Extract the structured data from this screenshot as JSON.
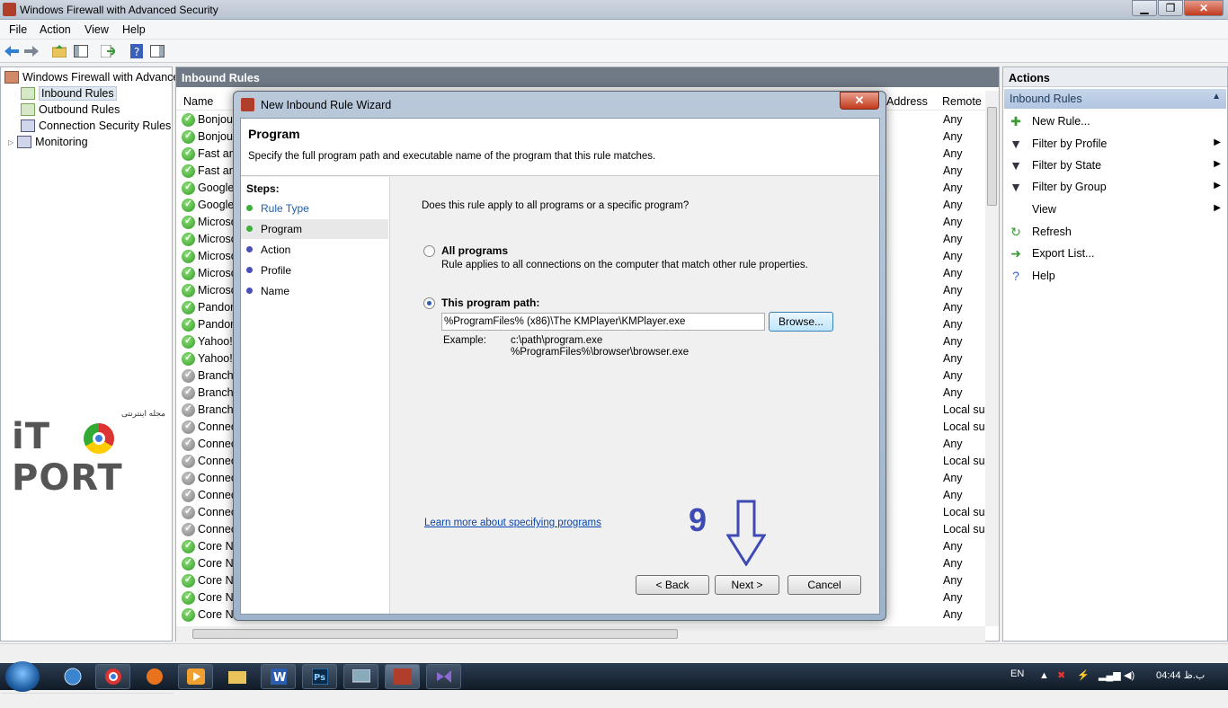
{
  "window": {
    "title": "Windows Firewall with Advanced Security",
    "min": "▁",
    "max": "❐",
    "close": "✕"
  },
  "menu": [
    "File",
    "Action",
    "View",
    "Help"
  ],
  "tree": {
    "root": "Windows Firewall with Advance",
    "items": [
      "Inbound Rules",
      "Outbound Rules",
      "Connection Security Rules",
      "Monitoring"
    ]
  },
  "watermark": {
    "text": "iT PORT",
    "sub": "مجله اینترنتی"
  },
  "center": {
    "header": "Inbound Rules",
    "columns": [
      "Name",
      "Address",
      "Remote"
    ],
    "rows": [
      {
        "name": "Bonjou",
        "remote": "Any",
        "enabled": true
      },
      {
        "name": "Bonjou",
        "remote": "Any",
        "enabled": true
      },
      {
        "name": "Fast an",
        "remote": "Any",
        "enabled": true
      },
      {
        "name": "Fast an",
        "remote": "Any",
        "enabled": true
      },
      {
        "name": "Google",
        "remote": "Any",
        "enabled": true
      },
      {
        "name": "Google",
        "remote": "Any",
        "enabled": true
      },
      {
        "name": "Microso",
        "remote": "Any",
        "enabled": true
      },
      {
        "name": "Microso",
        "remote": "Any",
        "enabled": true
      },
      {
        "name": "Microso",
        "remote": "Any",
        "enabled": true
      },
      {
        "name": "Microso",
        "remote": "Any",
        "enabled": true
      },
      {
        "name": "Microso",
        "remote": "Any",
        "enabled": true
      },
      {
        "name": "Pandora",
        "remote": "Any",
        "enabled": true
      },
      {
        "name": "Pandora",
        "remote": "Any",
        "enabled": true
      },
      {
        "name": "Yahoo!",
        "remote": "Any",
        "enabled": true
      },
      {
        "name": "Yahoo!",
        "remote": "Any",
        "enabled": true
      },
      {
        "name": "BranchC",
        "remote": "Any",
        "enabled": false
      },
      {
        "name": "BranchC",
        "remote": "Any",
        "enabled": false
      },
      {
        "name": "BranchC",
        "remote": "Local su",
        "enabled": false
      },
      {
        "name": "Connec",
        "remote": "Local su",
        "enabled": false
      },
      {
        "name": "Connec",
        "remote": "Any",
        "enabled": false
      },
      {
        "name": "Connec",
        "remote": "Local su",
        "enabled": false
      },
      {
        "name": "Connec",
        "remote": "Any",
        "enabled": false
      },
      {
        "name": "Connec",
        "remote": "Any",
        "enabled": false
      },
      {
        "name": "Connec",
        "remote": "Local su",
        "enabled": false
      },
      {
        "name": "Connec",
        "remote": "Local su",
        "enabled": false
      },
      {
        "name": "Core Ne",
        "remote": "Any",
        "enabled": true
      },
      {
        "name": "Core Ne",
        "remote": "Any",
        "enabled": true
      },
      {
        "name": "Core Ne",
        "remote": "Any",
        "enabled": true
      },
      {
        "name": "Core Ne",
        "remote": "Any",
        "enabled": true
      },
      {
        "name": "Core Ne",
        "remote": "Any",
        "enabled": true
      }
    ]
  },
  "actions": {
    "header": "Actions",
    "section": "Inbound Rules",
    "items": [
      {
        "label": "New Rule...",
        "icon": "new-rule-icon",
        "submenu": false
      },
      {
        "label": "Filter by Profile",
        "icon": "filter-icon",
        "submenu": true
      },
      {
        "label": "Filter by State",
        "icon": "filter-icon",
        "submenu": true
      },
      {
        "label": "Filter by Group",
        "icon": "filter-icon",
        "submenu": true
      },
      {
        "label": "View",
        "icon": "",
        "submenu": true
      },
      {
        "label": "Refresh",
        "icon": "refresh-icon",
        "submenu": false
      },
      {
        "label": "Export List...",
        "icon": "export-icon",
        "submenu": false
      },
      {
        "label": "Help",
        "icon": "help-icon",
        "submenu": false
      }
    ]
  },
  "dialog": {
    "title": "New Inbound Rule Wizard",
    "heading": "Program",
    "description": "Specify the full program path and executable name of the program that this rule matches.",
    "steps_title": "Steps:",
    "steps": [
      "Rule Type",
      "Program",
      "Action",
      "Profile",
      "Name"
    ],
    "question": "Does this rule apply to all programs or a specific program?",
    "all_programs_label": "All programs",
    "all_programs_desc": "Rule applies to all connections on the computer that match other rule properties.",
    "this_path_label": "This program path:",
    "path_value": "%ProgramFiles% (x86)\\The KMPlayer\\KMPlayer.exe",
    "browse": "Browse...",
    "example_label": "Example:",
    "example_1": "c:\\path\\program.exe",
    "example_2": "%ProgramFiles%\\browser\\browser.exe",
    "learn_more": "Learn more about specifying programs",
    "back": "< Back",
    "next": "Next >",
    "cancel": "Cancel"
  },
  "annotation": "9",
  "tray": {
    "lang": "EN",
    "time": "04:44 ب.ظ"
  },
  "colors": {
    "accent": "#3f4bb5",
    "header": "#707a86",
    "link": "#0645ad"
  }
}
